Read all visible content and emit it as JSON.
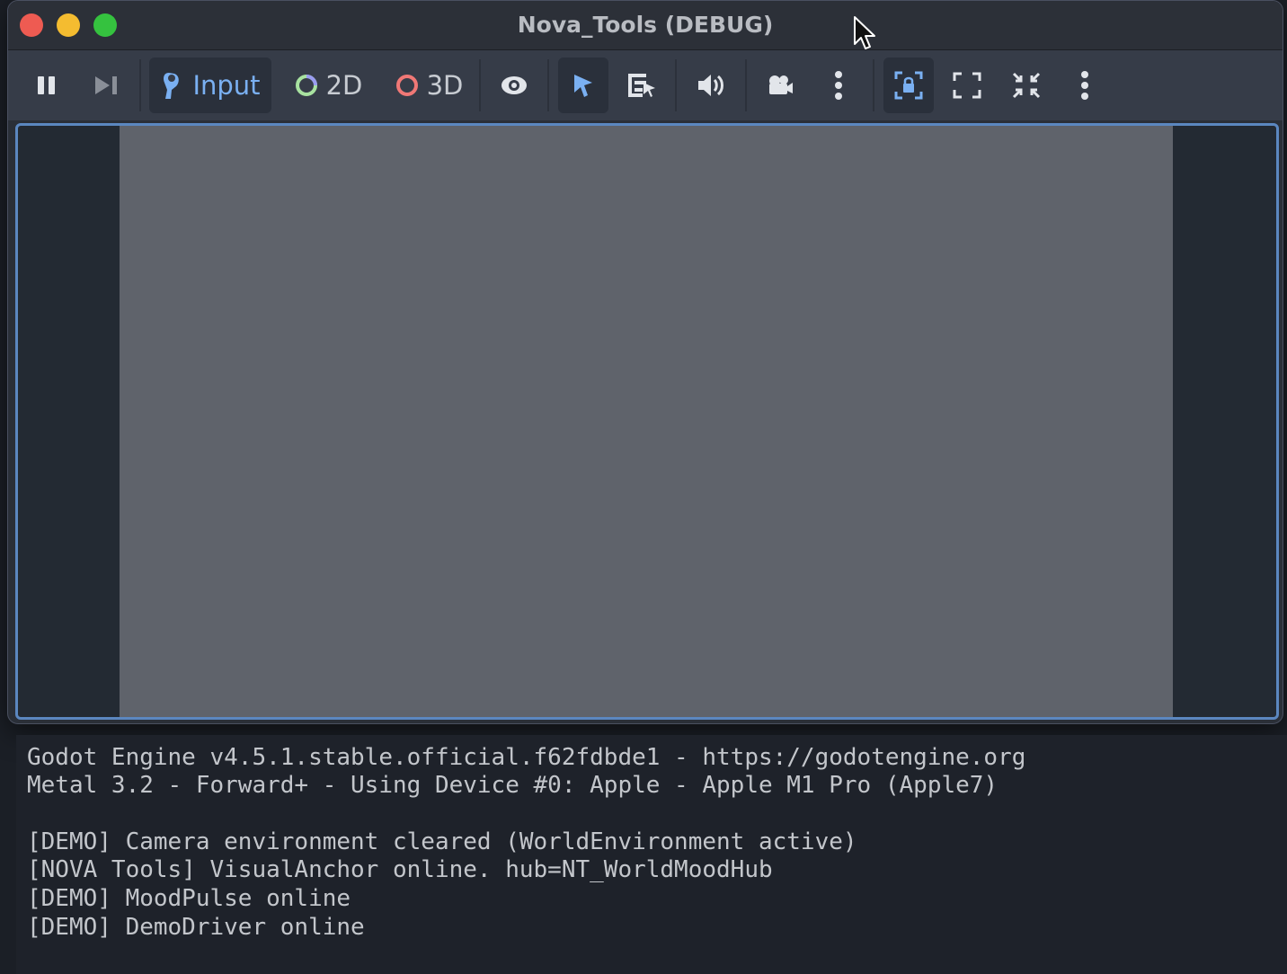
{
  "window": {
    "title": "Nova_Tools (DEBUG)"
  },
  "toolbar": {
    "input_label": "Input",
    "mode_2d_label": "2D",
    "mode_3d_label": "3D",
    "accent_color": "#7ab0f2",
    "icons": [
      "pause-icon",
      "next-frame-icon",
      "input-icon",
      "circle-2d-icon",
      "circle-3d-icon",
      "eye-icon",
      "select-arrow-icon",
      "list-select-icon",
      "speaker-icon",
      "camera-icon",
      "more-vertical-icon",
      "lock-frame-icon",
      "fullscreen-icon",
      "fullscreen-exit-icon",
      "more-vertical-icon"
    ]
  },
  "console": {
    "lines": [
      "Godot Engine v4.5.1.stable.official.f62fdbde1 - https://godotengine.org",
      "Metal 3.2 - Forward+ - Using Device #0: Apple - Apple M1 Pro (Apple7)",
      "",
      "[DEMO] Camera environment cleared (WorldEnvironment active)",
      "[NOVA Tools] VisualAnchor online. hub=NT_WorldMoodHub",
      "[DEMO] MoodPulse online",
      "[DEMO] DemoDriver online"
    ]
  }
}
